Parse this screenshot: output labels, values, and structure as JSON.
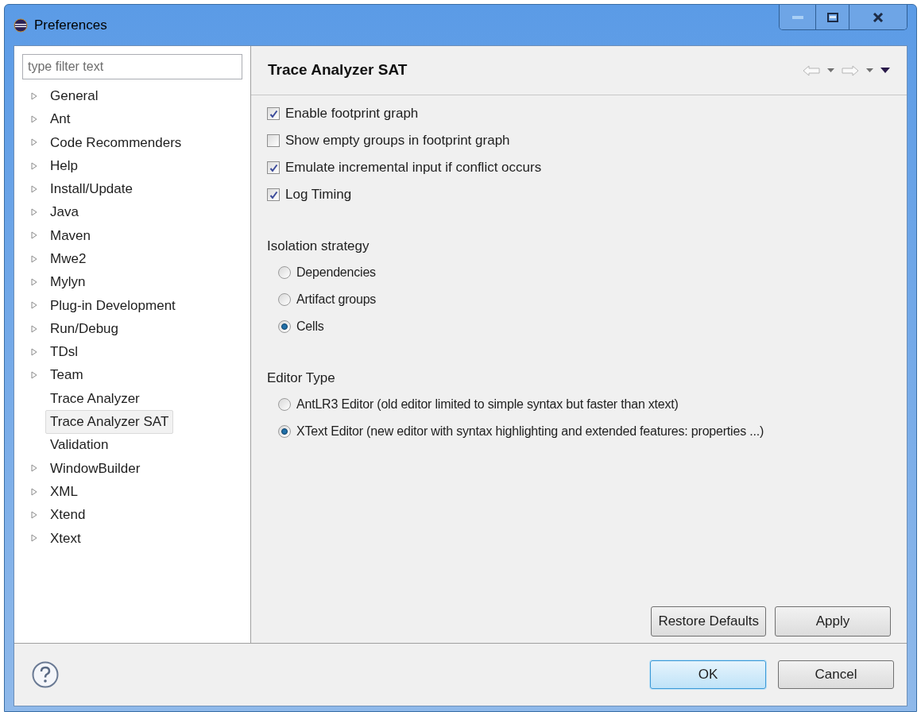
{
  "window": {
    "title": "Preferences"
  },
  "filter": {
    "placeholder": "type filter text"
  },
  "tree": [
    {
      "label": "General",
      "expandable": true,
      "selected": false
    },
    {
      "label": "Ant",
      "expandable": true,
      "selected": false
    },
    {
      "label": "Code Recommenders",
      "expandable": true,
      "selected": false
    },
    {
      "label": "Help",
      "expandable": true,
      "selected": false
    },
    {
      "label": "Install/Update",
      "expandable": true,
      "selected": false
    },
    {
      "label": "Java",
      "expandable": true,
      "selected": false
    },
    {
      "label": "Maven",
      "expandable": true,
      "selected": false
    },
    {
      "label": "Mwe2",
      "expandable": true,
      "selected": false
    },
    {
      "label": "Mylyn",
      "expandable": true,
      "selected": false
    },
    {
      "label": "Plug-in Development",
      "expandable": true,
      "selected": false
    },
    {
      "label": "Run/Debug",
      "expandable": true,
      "selected": false
    },
    {
      "label": "TDsl",
      "expandable": true,
      "selected": false
    },
    {
      "label": "Team",
      "expandable": true,
      "selected": false
    },
    {
      "label": "Trace Analyzer",
      "expandable": false,
      "selected": false
    },
    {
      "label": "Trace Analyzer SAT",
      "expandable": false,
      "selected": true
    },
    {
      "label": "Validation",
      "expandable": false,
      "selected": false
    },
    {
      "label": "WindowBuilder",
      "expandable": true,
      "selected": false
    },
    {
      "label": "XML",
      "expandable": true,
      "selected": false
    },
    {
      "label": "Xtend",
      "expandable": true,
      "selected": false
    },
    {
      "label": "Xtext",
      "expandable": true,
      "selected": false
    }
  ],
  "page": {
    "title": "Trace Analyzer SAT",
    "checkboxes": [
      {
        "label": "Enable footprint graph",
        "checked": true
      },
      {
        "label": "Show empty groups in footprint graph",
        "checked": false
      },
      {
        "label": "Emulate incremental input if conflict occurs",
        "checked": true
      },
      {
        "label": "Log Timing",
        "checked": true
      }
    ],
    "radio_groups": [
      {
        "title": "Isolation strategy",
        "options": [
          {
            "label": "Dependencies",
            "selected": false
          },
          {
            "label": "Artifact groups",
            "selected": false
          },
          {
            "label": "Cells",
            "selected": true
          }
        ]
      },
      {
        "title": "Editor Type",
        "options": [
          {
            "label": "AntLR3 Editor (old editor limited to simple syntax but faster than xtext)",
            "selected": false
          },
          {
            "label": "XText Editor (new editor with syntax highlighting and extended features: properties ...)",
            "selected": true
          }
        ]
      }
    ],
    "buttons": [
      "Restore Defaults",
      "Apply"
    ]
  },
  "footer_buttons": [
    {
      "label": "OK",
      "kind": "default"
    },
    {
      "label": "Cancel",
      "kind": "normal"
    }
  ]
}
